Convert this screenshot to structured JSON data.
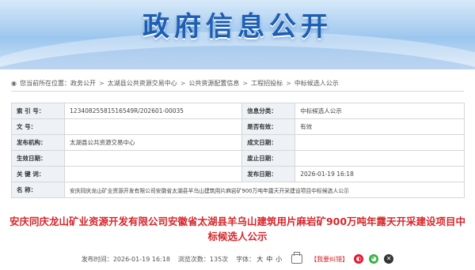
{
  "banner": {
    "title": "政府信息公开"
  },
  "breadcrumb": {
    "prefix": "您当前所在位置：",
    "items": [
      "政务公开",
      "太湖县公共资源交易中心",
      "公共资源配置信息",
      "工程招投标",
      "中标候选人公示"
    ],
    "separator": ">"
  },
  "meta": {
    "rows": [
      {
        "k1": "索 引 号：",
        "v1": "12340825581516549R/202601-00035",
        "k2": "信息分类：",
        "v2": "中标候选人公示"
      },
      {
        "k1": "文      号：",
        "v1": "",
        "k2": "是否有效：",
        "v2": "有效"
      },
      {
        "k1": "发布机构：",
        "v1": "太湖县公共资源交易中心",
        "k2": "成文日期：",
        "v2": ""
      },
      {
        "k1": "生效日期：",
        "v1": "",
        "k2": "废止日期：",
        "v2": ""
      },
      {
        "k1": "关 键 词：",
        "v1": "",
        "k2": "发布日期：",
        "v2": "2026-01-19 16:18"
      }
    ],
    "name_label": "名      称：",
    "name_value": "安庆同庆龙山矿业资源开发有限公司安徽省太湖县羊乌山建筑用片麻岩矿900万吨年露天开采建设项目中标候选人公示"
  },
  "doc_title": "安庆同庆龙山矿业资源开发有限公司安徽省太湖县羊乌山建筑用片麻岩矿900万吨年露天开采建设项目中标候选人公示",
  "footer": {
    "published_label": "发布时间：",
    "published_value": "2026-01-19 16:18",
    "views_label": "浏览次数：",
    "views_value": "135次",
    "font_label": "字体：",
    "font_large": "大",
    "font_medium": "中",
    "font_small": "小",
    "error_report": "【我要纠错】"
  },
  "colors": {
    "title_red": "#d7262b",
    "banner_blue": "#1d5fb4",
    "wechat": "#3bb34a",
    "weibo": "#e6162d"
  }
}
